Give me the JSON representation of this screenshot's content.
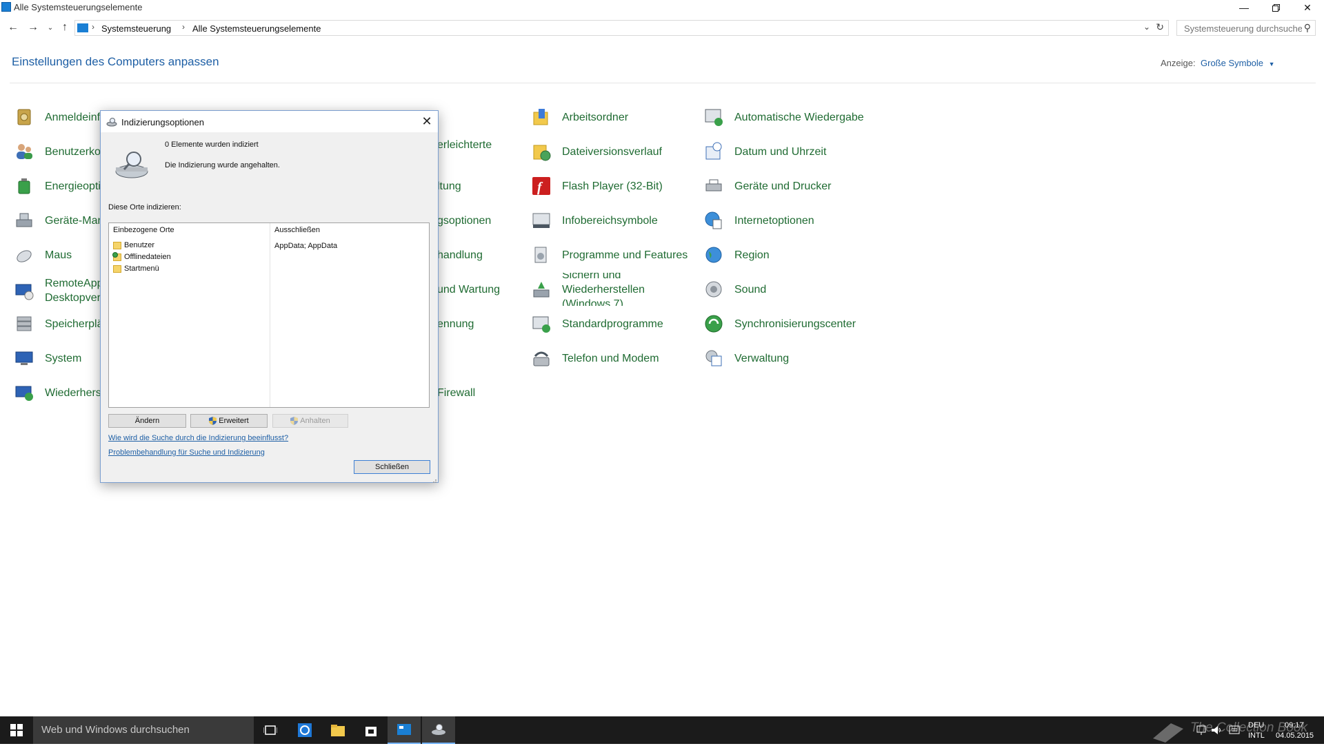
{
  "window": {
    "title": "Alle Systemsteuerungselemente"
  },
  "address": {
    "crumbs": [
      "Systemsteuerung",
      "Alle Systemsteuerungselemente"
    ],
    "search_placeholder": "Systemsteuerung durchsuchen"
  },
  "header": {
    "title": "Einstellungen des Computers anpassen",
    "view_label": "Anzeige:",
    "view_value": "Große Symbole"
  },
  "items": {
    "col1": [
      "Anmeldeinf",
      "Benutzerkon",
      "Energieoptic",
      "Geräte-Man",
      "Maus",
      "RemoteApp\nDesktopverb",
      "Speicherplä",
      "System",
      "Wiederherst"
    ],
    "col3": [
      "erleichterte",
      "ltung",
      "gsoptionen",
      "handlung",
      "und Wartung",
      "ennung",
      "Firewall"
    ],
    "col4": [
      "Arbeitsordner",
      "Dateiversionsverlauf",
      "Flash Player (32-Bit)",
      "Infobereichsymbole",
      "Programme und Features",
      "Sichern und Wiederherstellen (Windows 7)",
      "Standardprogramme",
      "Telefon und Modem"
    ],
    "col5": [
      "Automatische Wiedergabe",
      "Datum und Uhrzeit",
      "Geräte und Drucker",
      "Internetoptionen",
      "Region",
      "Sound",
      "Synchronisierungscenter",
      "Verwaltung"
    ]
  },
  "dialog": {
    "title": "Indizierungsoptionen",
    "status_count": "0 Elemente wurden indiziert",
    "status_state": "Die Indizierung wurde angehalten.",
    "locations_label": "Diese Orte indizieren:",
    "col_included": "Einbezogene Orte",
    "col_excluded": "Ausschließen",
    "locations": [
      {
        "name": "Benutzer",
        "exclude": "AppData; AppData"
      },
      {
        "name": "Offlinedateien",
        "exclude": ""
      },
      {
        "name": "Startmenü",
        "exclude": ""
      }
    ],
    "btn_change": "Ändern",
    "btn_advanced": "Erweitert",
    "btn_pause": "Anhalten",
    "link_howto": "Wie wird die Suche durch die Indizierung beeinflusst?",
    "link_troubleshoot": "Problembehandlung für Suche und Indizierung",
    "btn_close": "Schließen"
  },
  "taskbar": {
    "search_placeholder": "Web und Windows durchsuchen",
    "lang_top": "DEU",
    "lang_bottom": "INTL",
    "time": "09:17",
    "date": "04.05.2015",
    "watermark": "The Collection Book"
  }
}
